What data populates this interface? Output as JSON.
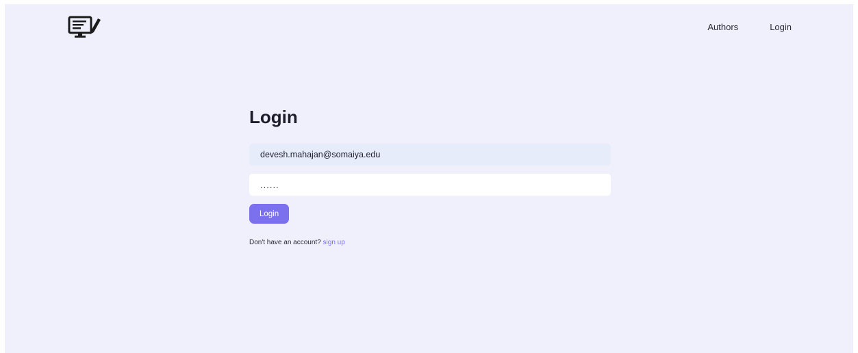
{
  "nav": {
    "items": [
      {
        "label": "Authors"
      },
      {
        "label": "Login"
      }
    ]
  },
  "logo": {
    "icon": "monitor-edit-icon"
  },
  "form": {
    "title": "Login",
    "email_value": "devesh.mahajan@somaiya.edu",
    "password_value": "......",
    "submit_label": "Login",
    "signup_prompt": "Don't have an account?",
    "signup_link": "sign up"
  },
  "colors": {
    "background": "#f0f0fc",
    "accent": "#7b70ee",
    "email_field_bg": "#e6ecfa",
    "text": "#1c1c2b"
  }
}
